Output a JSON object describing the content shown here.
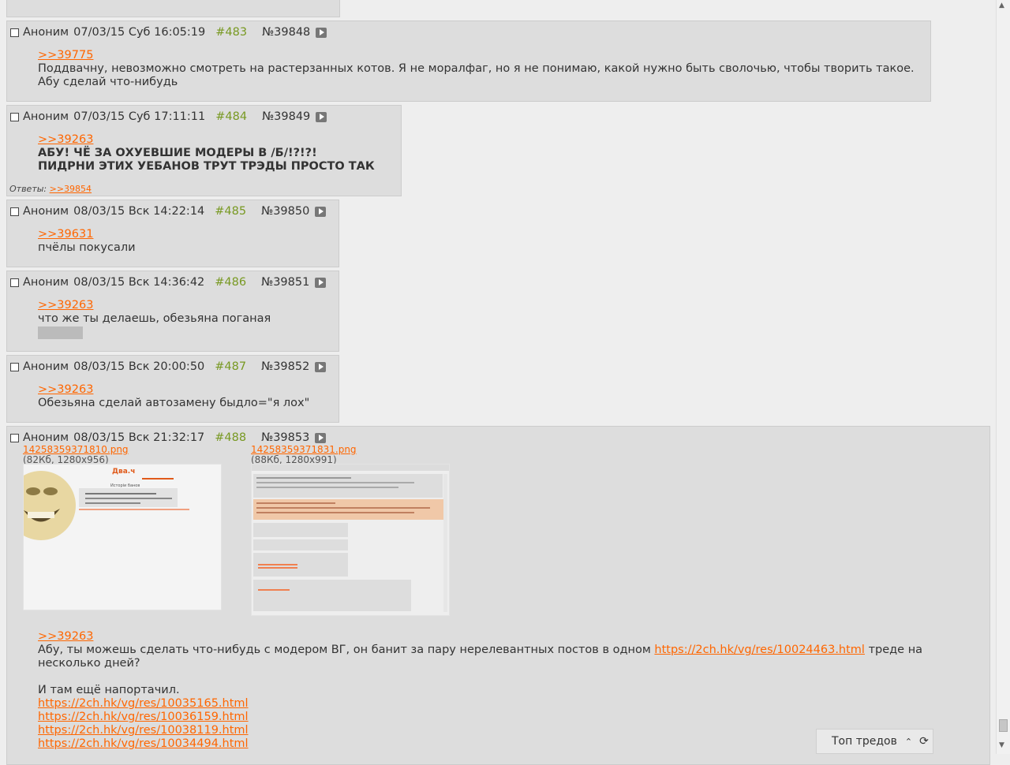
{
  "posts": [
    {
      "name": "Аноним",
      "date": "07/03/15 Суб 16:05:19",
      "num": "#483",
      "no": "№39848",
      "reply": ">>39775",
      "lines": [
        "Поддвачну, невозможно смотреть на растерзанных котов. Я не моралфаг, но я не понимаю, какой нужно быть сволочью, чтобы творить такое.",
        "Абу сделай что-нибудь"
      ]
    },
    {
      "name": "Аноним",
      "date": "07/03/15 Суб 17:11:11",
      "num": "#484",
      "no": "№39849",
      "reply": ">>39263",
      "lines": [
        "АБУ! ЧЁ ЗА ОХУЕВШИЕ МОДЕРЫ В /Б/!?!?!",
        "ПИДРНИ ЭТИХ УЕБАНОВ ТРУТ ТРЭДЫ ПРОСТО ТАК"
      ],
      "replies_label": "Ответы:",
      "replies_link": ">>39854"
    },
    {
      "name": "Аноним",
      "date": "08/03/15 Вск 14:22:14",
      "num": "#485",
      "no": "№39850",
      "reply": ">>39631",
      "lines": [
        "пчёлы покусали"
      ]
    },
    {
      "name": "Аноним",
      "date": "08/03/15 Вск 14:36:42",
      "num": "#486",
      "no": "№39851",
      "reply": ">>39263",
      "lines": [
        "что же ты делаешь, обезьяна поганая"
      ]
    },
    {
      "name": "Аноним",
      "date": "08/03/15 Вск 20:00:50",
      "num": "#487",
      "no": "№39852",
      "reply": ">>39263",
      "lines": [
        "Обезьяна сделай автозамену быдло=\"я лох\""
      ]
    },
    {
      "name": "Аноним",
      "date": "08/03/15 Вск 21:32:17",
      "num": "#488",
      "no": "№39853",
      "files": [
        {
          "name": "14258359371810.png",
          "info": "(82Кб, 1280x956)",
          "thumb_title": "Два.ч",
          "thumb_heading": "Исторіи банов"
        },
        {
          "name": "14258359371831.png",
          "info": "(88Кб, 1280x991)"
        }
      ],
      "reply": ">>39263",
      "text1_before": "Абу, ты можешь сделать что-нибудь с модером ВГ, он банит за пару нерелевантных постов в одном ",
      "text1_link": "https://2ch.hk/vg/res/10024463.html",
      "text1_after": " треде на",
      "text2": "несколько дней?",
      "text3": "И там ещё напортачил.",
      "links": [
        "https://2ch.hk/vg/res/10035165.html",
        "https://2ch.hk/vg/res/10036159.html",
        "https://2ch.hk/vg/res/10038119.html",
        "https://2ch.hk/vg/res/10034494.html"
      ]
    }
  ],
  "top_threads": {
    "label": "Топ тредов",
    "up_icon": "double-chevron-up-icon",
    "refresh_icon": "refresh-icon"
  },
  "colors": {
    "background": "#eeeeee",
    "post_bg": "#dddddd",
    "link": "#ff6600",
    "post_num": "#789922"
  }
}
